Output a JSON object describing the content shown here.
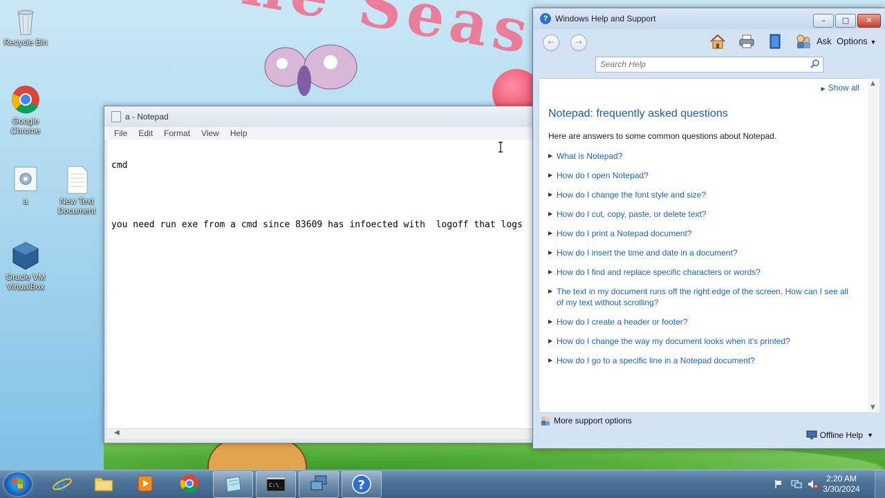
{
  "desktop": {
    "wallpaper_text": "The Season of",
    "icons": [
      {
        "label": "Recycle Bin",
        "icon": "recycle-bin-icon"
      },
      {
        "label": "Google Chrome",
        "icon": "chrome-icon"
      },
      {
        "label": "a",
        "icon": "settings-file-icon"
      },
      {
        "label": "New Text Document",
        "icon": "text-document-icon"
      },
      {
        "label": "Oracle VM VirtualBox",
        "icon": "virtualbox-icon"
      }
    ]
  },
  "notepad": {
    "title": "a - Notepad",
    "menu": [
      "File",
      "Edit",
      "Format",
      "View",
      "Help"
    ],
    "lines": [
      "cmd",
      "",
      "you need run exe from a cmd since 83609 has infoected with  logoff that logs"
    ]
  },
  "help": {
    "title": "Windows Help and Support",
    "toolbar": {
      "back": "back-icon",
      "forward": "forward-icon",
      "home": "home-icon",
      "print": "print-icon",
      "browse": "browse-help-icon",
      "ask_label": "Ask",
      "options_label": "Options"
    },
    "search": {
      "placeholder": "Search Help"
    },
    "show_all": "Show all",
    "heading": "Notepad: frequently asked questions",
    "intro": "Here are answers to some common questions about Notepad.",
    "faqs": [
      "What is Notepad?",
      "How do I open Notepad?",
      "How do I change the font style and size?",
      "How do I cut, copy, paste, or delete text?",
      "How do I print a Notepad document?",
      "How do I insert the time and date in a document?",
      "How do I find and replace specific characters or words?",
      "The text in my document runs off the right edge of the screen. How can I see all of my text without scrolling?",
      "How do I create a header or footer?",
      "How do I change the way my document looks when it's printed?",
      "How do I go to a specific line in a Notepad document?"
    ],
    "more_support": "More support options",
    "offline_help": "Offline Help"
  },
  "taskbar": {
    "items": [
      {
        "name": "internet-explorer",
        "icon": "ie-icon",
        "active": false
      },
      {
        "name": "file-explorer",
        "icon": "folder-icon",
        "active": false
      },
      {
        "name": "media-player",
        "icon": "media-player-icon",
        "active": false
      },
      {
        "name": "chrome",
        "icon": "chrome-icon",
        "active": false
      },
      {
        "name": "notepad",
        "icon": "notepad-icon",
        "active": true
      },
      {
        "name": "command-prompt",
        "icon": "cmd-icon",
        "active": true
      },
      {
        "name": "remote-desktop",
        "icon": "remote-desktop-icon",
        "active": true
      },
      {
        "name": "help-and-support",
        "icon": "help-icon",
        "active": true
      }
    ],
    "clock": {
      "time": "2:20 AM",
      "date": "3/30/2024"
    }
  },
  "colors": {
    "link": "#1d64b8",
    "heading": "#1d5aa6",
    "taskbar": "#4c7398",
    "close_button": "#c8412c"
  }
}
